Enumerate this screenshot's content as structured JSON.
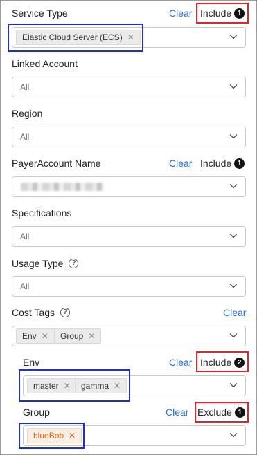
{
  "filters": {
    "service_type": {
      "label": "Service Type",
      "clear": "Clear",
      "mode": "Include",
      "count": "1",
      "tags": [
        "Elastic Cloud Server (ECS)"
      ]
    },
    "linked_account": {
      "label": "Linked Account",
      "value": "All"
    },
    "region": {
      "label": "Region",
      "value": "All"
    },
    "payer_account": {
      "label": "PayerAccount Name",
      "clear": "Clear",
      "mode": "Include",
      "count": "1"
    },
    "specifications": {
      "label": "Specifications",
      "value": "All"
    },
    "usage_type": {
      "label": "Usage Type",
      "help": "?",
      "value": "All"
    },
    "cost_tags": {
      "label": "Cost Tags",
      "help": "?",
      "clear": "Clear",
      "tags": [
        "Env",
        "Group"
      ]
    },
    "env": {
      "label": "Env",
      "clear": "Clear",
      "mode": "Include",
      "count": "2",
      "tags": [
        "master",
        "gamma"
      ]
    },
    "group": {
      "label": "Group",
      "clear": "Clear",
      "mode": "Exclude",
      "count": "1",
      "tags": [
        "blueBob"
      ]
    }
  },
  "icons": {
    "remove": "✕",
    "dropdown": "chevron-down-icon"
  },
  "colors": {
    "link": "#2a6ed8",
    "highlight_red": "#e8222b",
    "highlight_blue": "#1f2fd0",
    "tag_orange": "#d5641c"
  }
}
